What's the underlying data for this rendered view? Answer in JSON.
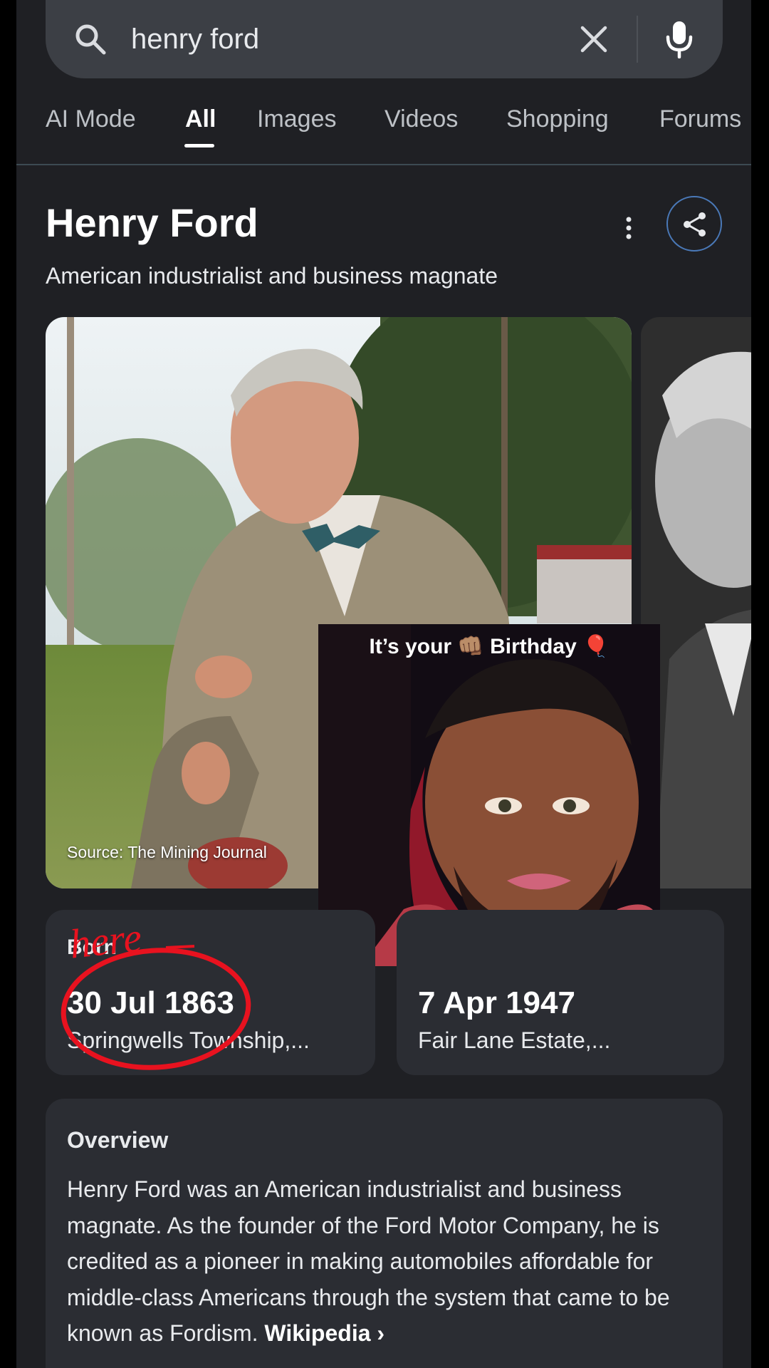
{
  "search": {
    "query": "henry ford"
  },
  "tabs": [
    {
      "label": "AI Mode"
    },
    {
      "label": "All"
    },
    {
      "label": "Images"
    },
    {
      "label": "Videos"
    },
    {
      "label": "Shopping"
    },
    {
      "label": "Forums"
    }
  ],
  "entity": {
    "title": "Henry Ford",
    "subtitle": "American industrialist and business magnate"
  },
  "photo": {
    "source": "Source: The Mining Journal"
  },
  "overlay": {
    "caption": "It’s your 👊🏽 Birthday 🎈"
  },
  "facts": {
    "born": {
      "label": "Born",
      "date": "30 Jul 1863",
      "place": "Springwells Township,..."
    },
    "died": {
      "date": "7 Apr 1947",
      "place": "Fair Lane Estate,..."
    }
  },
  "annotation": {
    "text": "here",
    "color": "#e8121f"
  },
  "overview": {
    "title": "Overview",
    "text": "Henry Ford was an American industrialist and business magnate. As the founder of the Ford Motor Company, he is credited as a pioneer in making automobiles affordable for middle-class Americans through the system that came to be known as Fordism.",
    "link": "Wikipedia ›"
  }
}
